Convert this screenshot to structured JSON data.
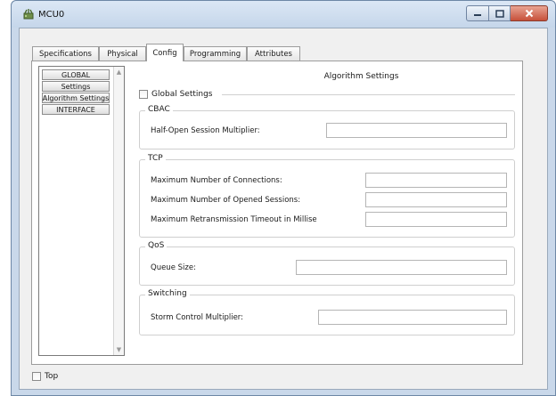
{
  "window": {
    "title": "MCU0",
    "controls": {
      "minimize": "minimize-icon",
      "maximize": "maximize-icon",
      "close": "close-icon"
    }
  },
  "tabs": [
    {
      "label": "Specifications",
      "active": false
    },
    {
      "label": "Physical",
      "active": false
    },
    {
      "label": "Config",
      "active": true
    },
    {
      "label": "Programming",
      "active": false
    },
    {
      "label": "Attributes",
      "active": false
    }
  ],
  "sidebar": {
    "items": [
      {
        "label": "GLOBAL"
      },
      {
        "label": "Settings"
      },
      {
        "label": "Algorithm Settings"
      },
      {
        "label": "INTERFACE"
      }
    ]
  },
  "content": {
    "title": "Algorithm Settings",
    "global_settings": {
      "label": "Global Settings",
      "checked": false
    },
    "cbac": {
      "title": "CBAC",
      "half_open_label": "Half-Open Session Multiplier:",
      "half_open_value": ""
    },
    "tcp": {
      "title": "TCP",
      "max_connections_label": "Maximum Number of Connections:",
      "max_connections_value": "",
      "max_sessions_label": "Maximum Number of Opened Sessions:",
      "max_sessions_value": "",
      "max_retrans_label": "Maximum Retransmission Timeout in Millise",
      "max_retrans_value": ""
    },
    "qos": {
      "title": "QoS",
      "queue_size_label": "Queue Size:",
      "queue_size_value": ""
    },
    "switching": {
      "title": "Switching",
      "storm_label": "Storm Control Multiplier:",
      "storm_value": ""
    }
  },
  "footer": {
    "top_label": "Top",
    "top_checked": false
  }
}
